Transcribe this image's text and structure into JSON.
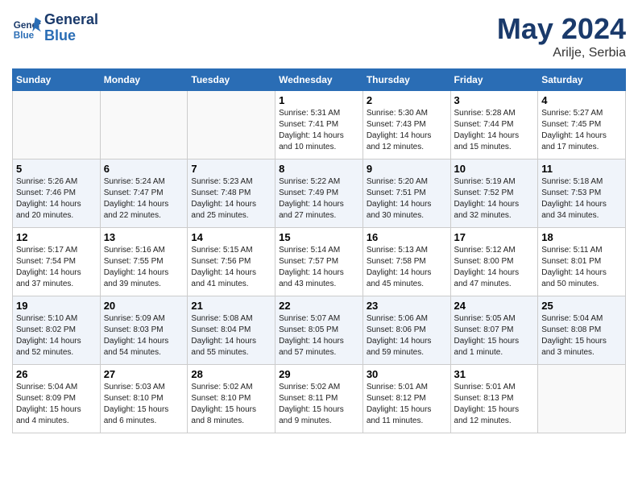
{
  "header": {
    "logo_line1": "General",
    "logo_line2": "Blue",
    "month": "May 2024",
    "location": "Arilje, Serbia"
  },
  "days_of_week": [
    "Sunday",
    "Monday",
    "Tuesday",
    "Wednesday",
    "Thursday",
    "Friday",
    "Saturday"
  ],
  "weeks": [
    [
      {
        "day": "",
        "info": ""
      },
      {
        "day": "",
        "info": ""
      },
      {
        "day": "",
        "info": ""
      },
      {
        "day": "1",
        "info": "Sunrise: 5:31 AM\nSunset: 7:41 PM\nDaylight: 14 hours\nand 10 minutes."
      },
      {
        "day": "2",
        "info": "Sunrise: 5:30 AM\nSunset: 7:43 PM\nDaylight: 14 hours\nand 12 minutes."
      },
      {
        "day": "3",
        "info": "Sunrise: 5:28 AM\nSunset: 7:44 PM\nDaylight: 14 hours\nand 15 minutes."
      },
      {
        "day": "4",
        "info": "Sunrise: 5:27 AM\nSunset: 7:45 PM\nDaylight: 14 hours\nand 17 minutes."
      }
    ],
    [
      {
        "day": "5",
        "info": "Sunrise: 5:26 AM\nSunset: 7:46 PM\nDaylight: 14 hours\nand 20 minutes."
      },
      {
        "day": "6",
        "info": "Sunrise: 5:24 AM\nSunset: 7:47 PM\nDaylight: 14 hours\nand 22 minutes."
      },
      {
        "day": "7",
        "info": "Sunrise: 5:23 AM\nSunset: 7:48 PM\nDaylight: 14 hours\nand 25 minutes."
      },
      {
        "day": "8",
        "info": "Sunrise: 5:22 AM\nSunset: 7:49 PM\nDaylight: 14 hours\nand 27 minutes."
      },
      {
        "day": "9",
        "info": "Sunrise: 5:20 AM\nSunset: 7:51 PM\nDaylight: 14 hours\nand 30 minutes."
      },
      {
        "day": "10",
        "info": "Sunrise: 5:19 AM\nSunset: 7:52 PM\nDaylight: 14 hours\nand 32 minutes."
      },
      {
        "day": "11",
        "info": "Sunrise: 5:18 AM\nSunset: 7:53 PM\nDaylight: 14 hours\nand 34 minutes."
      }
    ],
    [
      {
        "day": "12",
        "info": "Sunrise: 5:17 AM\nSunset: 7:54 PM\nDaylight: 14 hours\nand 37 minutes."
      },
      {
        "day": "13",
        "info": "Sunrise: 5:16 AM\nSunset: 7:55 PM\nDaylight: 14 hours\nand 39 minutes."
      },
      {
        "day": "14",
        "info": "Sunrise: 5:15 AM\nSunset: 7:56 PM\nDaylight: 14 hours\nand 41 minutes."
      },
      {
        "day": "15",
        "info": "Sunrise: 5:14 AM\nSunset: 7:57 PM\nDaylight: 14 hours\nand 43 minutes."
      },
      {
        "day": "16",
        "info": "Sunrise: 5:13 AM\nSunset: 7:58 PM\nDaylight: 14 hours\nand 45 minutes."
      },
      {
        "day": "17",
        "info": "Sunrise: 5:12 AM\nSunset: 8:00 PM\nDaylight: 14 hours\nand 47 minutes."
      },
      {
        "day": "18",
        "info": "Sunrise: 5:11 AM\nSunset: 8:01 PM\nDaylight: 14 hours\nand 50 minutes."
      }
    ],
    [
      {
        "day": "19",
        "info": "Sunrise: 5:10 AM\nSunset: 8:02 PM\nDaylight: 14 hours\nand 52 minutes."
      },
      {
        "day": "20",
        "info": "Sunrise: 5:09 AM\nSunset: 8:03 PM\nDaylight: 14 hours\nand 54 minutes."
      },
      {
        "day": "21",
        "info": "Sunrise: 5:08 AM\nSunset: 8:04 PM\nDaylight: 14 hours\nand 55 minutes."
      },
      {
        "day": "22",
        "info": "Sunrise: 5:07 AM\nSunset: 8:05 PM\nDaylight: 14 hours\nand 57 minutes."
      },
      {
        "day": "23",
        "info": "Sunrise: 5:06 AM\nSunset: 8:06 PM\nDaylight: 14 hours\nand 59 minutes."
      },
      {
        "day": "24",
        "info": "Sunrise: 5:05 AM\nSunset: 8:07 PM\nDaylight: 15 hours\nand 1 minute."
      },
      {
        "day": "25",
        "info": "Sunrise: 5:04 AM\nSunset: 8:08 PM\nDaylight: 15 hours\nand 3 minutes."
      }
    ],
    [
      {
        "day": "26",
        "info": "Sunrise: 5:04 AM\nSunset: 8:09 PM\nDaylight: 15 hours\nand 4 minutes."
      },
      {
        "day": "27",
        "info": "Sunrise: 5:03 AM\nSunset: 8:10 PM\nDaylight: 15 hours\nand 6 minutes."
      },
      {
        "day": "28",
        "info": "Sunrise: 5:02 AM\nSunset: 8:10 PM\nDaylight: 15 hours\nand 8 minutes."
      },
      {
        "day": "29",
        "info": "Sunrise: 5:02 AM\nSunset: 8:11 PM\nDaylight: 15 hours\nand 9 minutes."
      },
      {
        "day": "30",
        "info": "Sunrise: 5:01 AM\nSunset: 8:12 PM\nDaylight: 15 hours\nand 11 minutes."
      },
      {
        "day": "31",
        "info": "Sunrise: 5:01 AM\nSunset: 8:13 PM\nDaylight: 15 hours\nand 12 minutes."
      },
      {
        "day": "",
        "info": ""
      }
    ]
  ]
}
